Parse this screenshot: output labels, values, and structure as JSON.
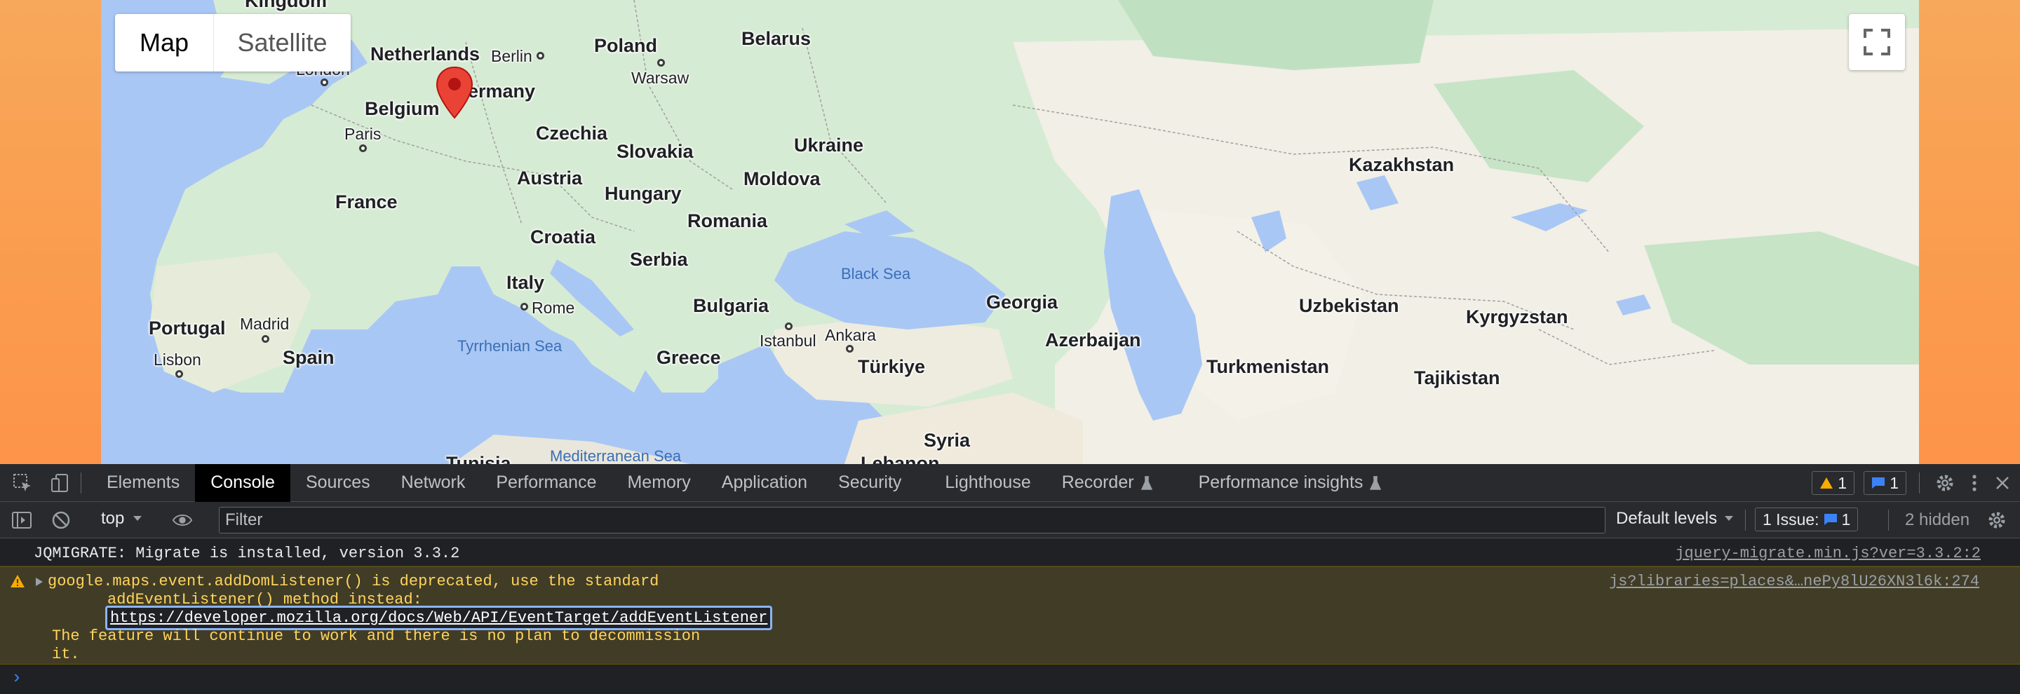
{
  "map": {
    "map_type_options": [
      "Map",
      "Satellite"
    ],
    "active_map_type": "Map",
    "labels": {
      "kingdom": "Kingdom",
      "netherlands": "Netherlands",
      "berlin": "Berlin",
      "poland": "Poland",
      "belarus": "Belarus",
      "warsaw": "Warsaw",
      "london": "London",
      "belgium": "Belgium",
      "germany": "Germany",
      "paris": "Paris",
      "czechia": "Czechia",
      "slovakia": "Slovakia",
      "ukraine": "Ukraine",
      "moldova": "Moldova",
      "kazakhstan": "Kazakhstan",
      "austria": "Austria",
      "hungary": "Hungary",
      "france": "France",
      "romania": "Romania",
      "croatia": "Croatia",
      "serbia": "Serbia",
      "black_sea": "Black Sea",
      "italy": "Italy",
      "rome": "Rome",
      "bulgaria": "Bulgaria",
      "georgia": "Georgia",
      "uzbekistan": "Uzbekistan",
      "kyrgyzstan": "Kyrgyzstan",
      "portugal": "Portugal",
      "madrid": "Madrid",
      "spain": "Spain",
      "tyrrhenian_sea": "Tyrrhenian Sea",
      "istanbul": "Istanbul",
      "ankara": "Ankara",
      "azerbaijan": "Azerbaijan",
      "lisbon": "Lisbon",
      "greece": "Greece",
      "turkiye": "Türkiye",
      "turkmenistan": "Turkmenistan",
      "tajikistan": "Tajikistan",
      "syria": "Syria",
      "tunisia": "Tunisia",
      "mediterranean_sea": "Mediterranean Sea",
      "lebanon": "Lebanon"
    },
    "colors": {
      "water": "#a9c7f5",
      "land": "#f1efe6",
      "forest": "#bfe1c8",
      "green_land": "#d4ecd1",
      "marker": "#ea4335"
    }
  },
  "devtools": {
    "tabs": [
      "Elements",
      "Console",
      "Sources",
      "Network",
      "Performance",
      "Memory",
      "Application",
      "Security",
      "Lighthouse",
      "Recorder",
      "Performance insights"
    ],
    "active_tab": "Console",
    "warning_count": "1",
    "message_count": "1",
    "toolbar": {
      "context": "top",
      "filter_placeholder": "Filter",
      "levels": "Default levels",
      "issues_label": "1 Issue:",
      "issues_count": "1",
      "hidden": "2 hidden"
    },
    "console": {
      "messages": [
        {
          "level": "info",
          "text": "JQMIGRATE: Migrate is installed, version 3.3.2",
          "source": "jquery-migrate.min.js?ver=3.3.2:2"
        },
        {
          "level": "warning",
          "line1": "google.maps.event.addDomListener() is deprecated, use the standard",
          "line2": "addEventListener() method instead:",
          "link": "https://developer.mozilla.org/docs/Web/API/EventTarget/addEventListener",
          "line4": "The feature will continue to work and there is no plan to decommission",
          "line5": "it.",
          "source": "js?libraries=places&…nePy8lU26XN3l6k:274"
        }
      ],
      "prompt_symbol": "›"
    },
    "colors": {
      "background": "#202124",
      "tabbar": "#292a2d",
      "warning_bg": "#413c26",
      "warning_text": "#ffd45c",
      "accent_blue": "#3b82f6"
    }
  }
}
